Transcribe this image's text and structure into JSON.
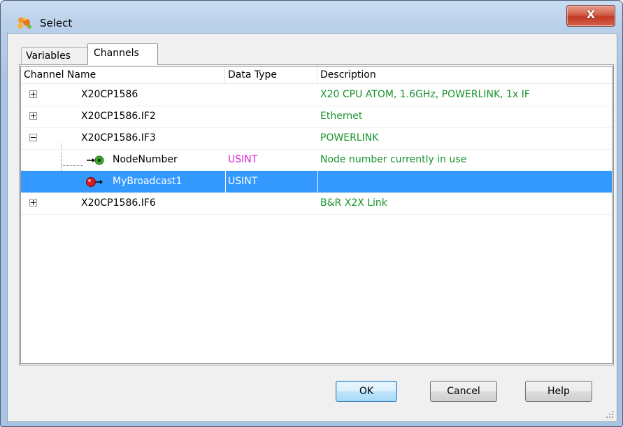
{
  "window": {
    "title": "Select",
    "close_glyph": "X"
  },
  "tabs": [
    {
      "label": "Variables"
    },
    {
      "label": "Channels"
    }
  ],
  "columns": [
    {
      "label": "Channel Name"
    },
    {
      "label": "Data Type"
    },
    {
      "label": "Description"
    }
  ],
  "rows": [
    {
      "name": "X20CP1586",
      "type": "",
      "description": "X20 CPU ATOM, 1.6GHz, POWERLINK, 1x IF",
      "expander": "plus"
    },
    {
      "name": "X20CP1586.IF2",
      "type": "",
      "description": "Ethernet",
      "expander": "plus"
    },
    {
      "name": "X20CP1586.IF3",
      "type": "",
      "description": "POWERLINK",
      "expander": "minus"
    },
    {
      "name": "NodeNumber",
      "type": "USINT",
      "description": "Node number currently in use",
      "icon": "green-input-channel-icon"
    },
    {
      "name": "MyBroadcast1",
      "type": "USINT",
      "description": "",
      "icon": "red-output-channel-icon",
      "selected": true
    },
    {
      "name": "X20CP1586.IF6",
      "type": "",
      "description": "B&R X2X Link",
      "expander": "plus"
    }
  ],
  "buttons": {
    "ok": "OK",
    "cancel": "Cancel",
    "help": "Help"
  },
  "colors": {
    "description_text": "#17932d",
    "type_text": "#e020e0",
    "selection": "#3399ff"
  }
}
